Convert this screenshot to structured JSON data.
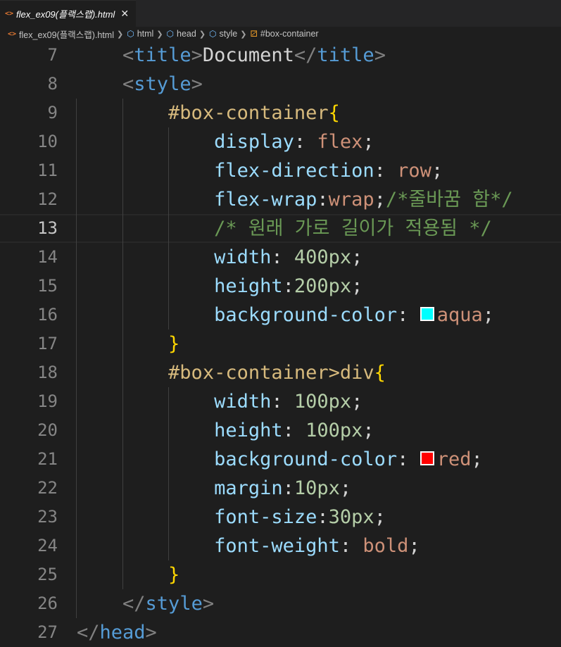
{
  "tab": {
    "icon": "<>",
    "label": "flex_ex09(플랙스랩).html",
    "close": "✕"
  },
  "breadcrumb": [
    {
      "icon": "html-file-icon",
      "label": "flex_ex09(플랙스랩).html"
    },
    {
      "icon": "cube-icon",
      "label": "html"
    },
    {
      "icon": "cube-icon",
      "label": "head"
    },
    {
      "icon": "cube-icon",
      "label": "style"
    },
    {
      "icon": "selector-icon",
      "label": "#box-container"
    }
  ],
  "colors": {
    "aqua_swatch": "#00ffff",
    "red_swatch": "#ff0000"
  },
  "current_line": "13",
  "lines": [
    {
      "n": "7",
      "tokens": [
        [
          "t-text",
          "    "
        ],
        [
          "t-punct",
          "<"
        ],
        [
          "t-tag",
          "title"
        ],
        [
          "t-punct",
          ">"
        ],
        [
          "t-text",
          "Document"
        ],
        [
          "t-punct",
          "</"
        ],
        [
          "t-tag",
          "title"
        ],
        [
          "t-punct",
          ">"
        ]
      ]
    },
    {
      "n": "8",
      "tokens": [
        [
          "t-text",
          "    "
        ],
        [
          "t-punct",
          "<"
        ],
        [
          "t-tag",
          "style"
        ],
        [
          "t-punct",
          ">"
        ]
      ]
    },
    {
      "n": "9",
      "tokens": [
        [
          "t-text",
          "        "
        ],
        [
          "t-sel",
          "#box-container"
        ],
        [
          "t-brace",
          "{"
        ]
      ]
    },
    {
      "n": "10",
      "tokens": [
        [
          "t-text",
          "            "
        ],
        [
          "t-prop",
          "display"
        ],
        [
          "t-text",
          ": "
        ],
        [
          "t-val",
          "flex"
        ],
        [
          "t-text",
          ";"
        ]
      ]
    },
    {
      "n": "11",
      "tokens": [
        [
          "t-text",
          "            "
        ],
        [
          "t-prop",
          "flex-direction"
        ],
        [
          "t-text",
          ": "
        ],
        [
          "t-val",
          "row"
        ],
        [
          "t-text",
          ";"
        ]
      ]
    },
    {
      "n": "12",
      "tokens": [
        [
          "t-text",
          "            "
        ],
        [
          "t-prop",
          "flex-wrap"
        ],
        [
          "t-text",
          ":"
        ],
        [
          "t-val",
          "wrap"
        ],
        [
          "t-text",
          ";"
        ],
        [
          "t-cmt",
          "/*줄바꿈 함*/"
        ]
      ]
    },
    {
      "n": "13",
      "tokens": [
        [
          "t-text",
          "            "
        ],
        [
          "t-cmt",
          "/* 원래 가로 길이가 적용됨 */"
        ]
      ]
    },
    {
      "n": "14",
      "tokens": [
        [
          "t-text",
          "            "
        ],
        [
          "t-prop",
          "width"
        ],
        [
          "t-text",
          ": "
        ],
        [
          "t-num",
          "400px"
        ],
        [
          "t-text",
          ";"
        ]
      ]
    },
    {
      "n": "15",
      "tokens": [
        [
          "t-text",
          "            "
        ],
        [
          "t-prop",
          "height"
        ],
        [
          "t-text",
          ":"
        ],
        [
          "t-num",
          "200px"
        ],
        [
          "t-text",
          ";"
        ]
      ]
    },
    {
      "n": "16",
      "tokens": [
        [
          "t-text",
          "            "
        ],
        [
          "t-prop",
          "background-color"
        ],
        [
          "t-text",
          ": "
        ],
        [
          "swatch",
          "aqua_swatch"
        ],
        [
          "t-val",
          "aqua"
        ],
        [
          "t-text",
          ";"
        ]
      ]
    },
    {
      "n": "17",
      "tokens": [
        [
          "t-text",
          "        "
        ],
        [
          "t-brace",
          "}"
        ]
      ]
    },
    {
      "n": "18",
      "tokens": [
        [
          "t-text",
          "        "
        ],
        [
          "t-sel",
          "#box-container>div"
        ],
        [
          "t-brace",
          "{"
        ]
      ]
    },
    {
      "n": "19",
      "tokens": [
        [
          "t-text",
          "            "
        ],
        [
          "t-prop",
          "width"
        ],
        [
          "t-text",
          ": "
        ],
        [
          "t-num",
          "100px"
        ],
        [
          "t-text",
          ";"
        ]
      ]
    },
    {
      "n": "20",
      "tokens": [
        [
          "t-text",
          "            "
        ],
        [
          "t-prop",
          "height"
        ],
        [
          "t-text",
          ": "
        ],
        [
          "t-num",
          "100px"
        ],
        [
          "t-text",
          ";"
        ]
      ]
    },
    {
      "n": "21",
      "tokens": [
        [
          "t-text",
          "            "
        ],
        [
          "t-prop",
          "background-color"
        ],
        [
          "t-text",
          ": "
        ],
        [
          "swatch",
          "red_swatch"
        ],
        [
          "t-val",
          "red"
        ],
        [
          "t-text",
          ";"
        ]
      ]
    },
    {
      "n": "22",
      "tokens": [
        [
          "t-text",
          "            "
        ],
        [
          "t-prop",
          "margin"
        ],
        [
          "t-text",
          ":"
        ],
        [
          "t-num",
          "10px"
        ],
        [
          "t-text",
          ";"
        ]
      ]
    },
    {
      "n": "23",
      "tokens": [
        [
          "t-text",
          "            "
        ],
        [
          "t-prop",
          "font-size"
        ],
        [
          "t-text",
          ":"
        ],
        [
          "t-num",
          "30px"
        ],
        [
          "t-text",
          ";"
        ]
      ]
    },
    {
      "n": "24",
      "tokens": [
        [
          "t-text",
          "            "
        ],
        [
          "t-prop",
          "font-weight"
        ],
        [
          "t-text",
          ": "
        ],
        [
          "t-val",
          "bold"
        ],
        [
          "t-text",
          ";"
        ]
      ]
    },
    {
      "n": "25",
      "tokens": [
        [
          "t-text",
          "        "
        ],
        [
          "t-brace",
          "}"
        ]
      ]
    },
    {
      "n": "26",
      "tokens": [
        [
          "t-text",
          "    "
        ],
        [
          "t-punct",
          "</"
        ],
        [
          "t-tag",
          "style"
        ],
        [
          "t-punct",
          ">"
        ]
      ]
    },
    {
      "n": "27",
      "tokens": [
        [
          "t-punct",
          "</"
        ],
        [
          "t-tag",
          "head"
        ],
        [
          "t-punct",
          ">"
        ]
      ]
    }
  ]
}
